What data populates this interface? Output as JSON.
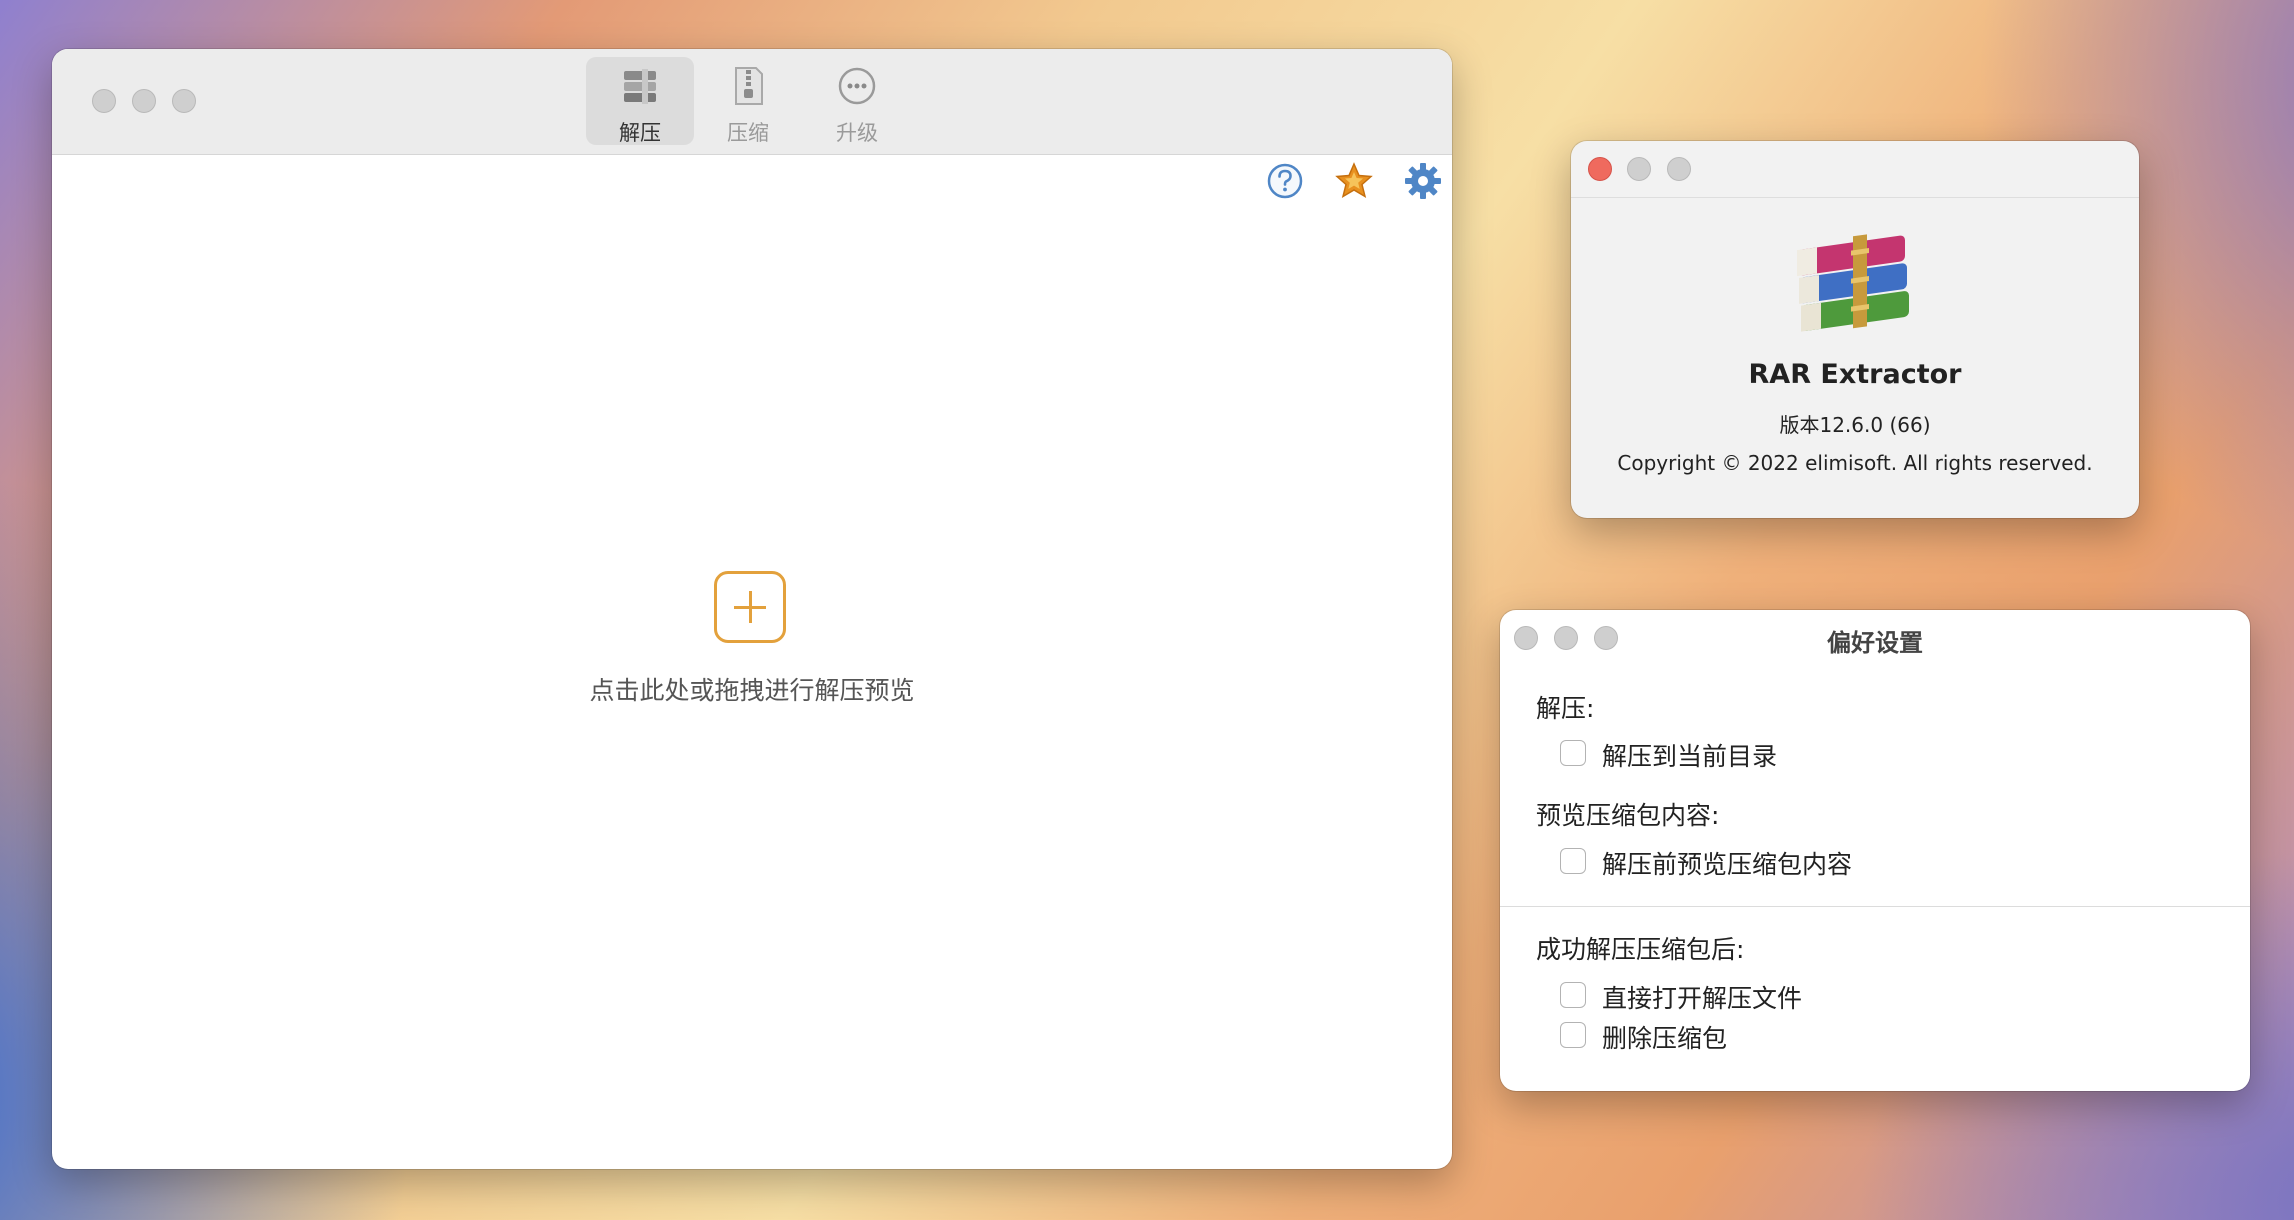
{
  "main_window": {
    "toolbar": {
      "extract_label": "解压",
      "compress_label": "压缩",
      "upgrade_label": "升级"
    },
    "drop_hint": "点击此处或拖拽进行解压预览",
    "icons": [
      "help-icon",
      "star-icon",
      "gear-icon",
      "plus-icon"
    ]
  },
  "about_window": {
    "app_name": "RAR Extractor",
    "version": "版本12.6.0 (66)",
    "copyright": "Copyright © 2022 elimisoft. All rights reserved."
  },
  "prefs_window": {
    "title": "偏好设置",
    "sections": [
      {
        "label": "解压:",
        "options": [
          {
            "label": "解压到当前目录",
            "checked": false
          }
        ]
      },
      {
        "label": "预览压缩包内容:",
        "options": [
          {
            "label": "解压前预览压缩包内容",
            "checked": false
          }
        ]
      },
      {
        "label": "成功解压压缩包后:",
        "options": [
          {
            "label": "直接打开解压文件",
            "checked": false
          },
          {
            "label": "删除压缩包",
            "checked": false
          }
        ]
      }
    ]
  },
  "colors": {
    "accent_orange": "#e3a13c",
    "close_red": "#ef6a5e",
    "gear_blue": "#4f86c6"
  }
}
